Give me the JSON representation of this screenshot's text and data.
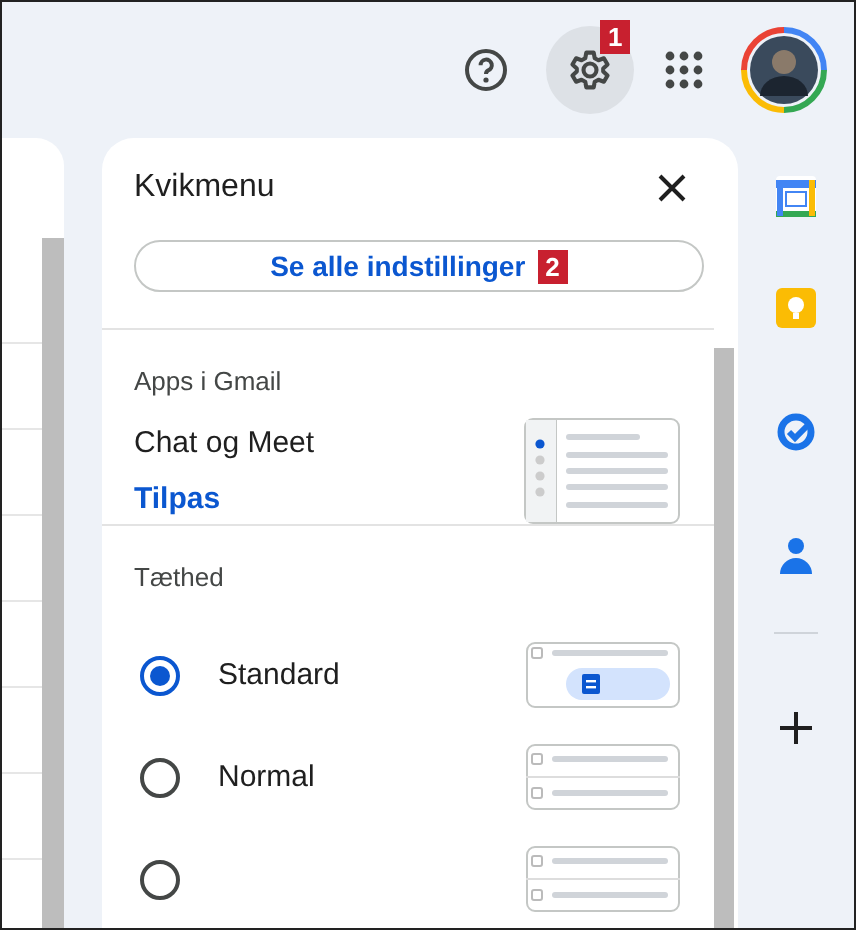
{
  "topbar": {
    "settings": {
      "active": true,
      "badge": "1"
    }
  },
  "quick_settings": {
    "title": "Kvikmenu",
    "all_settings_button": {
      "label": "Se alle indstillinger",
      "badge": "2"
    },
    "apps_section": {
      "heading": "Apps i Gmail",
      "label": "Chat og Meet",
      "link": "Tilpas"
    },
    "density": {
      "heading": "Tæthed",
      "options": [
        {
          "label": "Standard",
          "selected": true,
          "kind": "attachments"
        },
        {
          "label": "Normal",
          "selected": false,
          "kind": "plain"
        },
        {
          "selected": false,
          "kind": "plain"
        }
      ]
    }
  }
}
